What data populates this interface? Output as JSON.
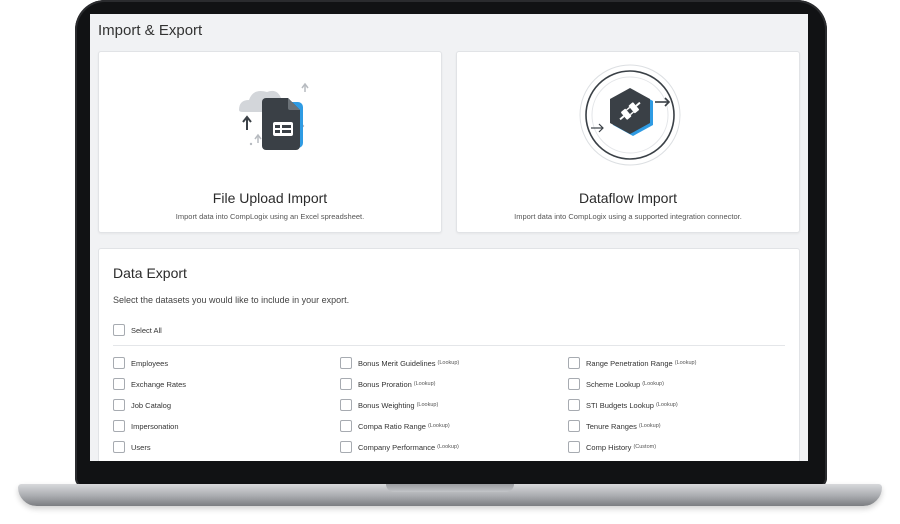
{
  "page": {
    "title": "Import & Export"
  },
  "import_cards": [
    {
      "title": "File Upload Import",
      "description": "Import data into CompLogix using an Excel spreadsheet."
    },
    {
      "title": "Dataflow Import",
      "description": "Import data into CompLogix using a supported integration connector."
    }
  ],
  "export": {
    "title": "Data Export",
    "subtitle": "Select the datasets you would like to include in your export.",
    "select_all_label": "Select All",
    "columns": [
      [
        {
          "label": "Employees",
          "tag": ""
        },
        {
          "label": "Exchange Rates",
          "tag": ""
        },
        {
          "label": "Job Catalog",
          "tag": ""
        },
        {
          "label": "Impersonation",
          "tag": ""
        },
        {
          "label": "Users",
          "tag": ""
        }
      ],
      [
        {
          "label": "Bonus Merit Guidelines",
          "tag": "(Lookup)"
        },
        {
          "label": "Bonus Proration",
          "tag": "(Lookup)"
        },
        {
          "label": "Bonus Weighting",
          "tag": "(Lookup)"
        },
        {
          "label": "Compa Ratio Range",
          "tag": "(Lookup)"
        },
        {
          "label": "Company Performance",
          "tag": "(Lookup)"
        }
      ],
      [
        {
          "label": "Range Penetration Range",
          "tag": "(Lookup)"
        },
        {
          "label": "Scheme Lookup",
          "tag": "(Lookup)"
        },
        {
          "label": "STI Budgets Lookup",
          "tag": "(Lookup)"
        },
        {
          "label": "Tenure Ranges",
          "tag": "(Lookup)"
        },
        {
          "label": "Comp History",
          "tag": "(Custom)"
        }
      ]
    ]
  },
  "colors": {
    "accent": "#2f9be3",
    "icon_dark": "#3a4046",
    "cloud": "#cfd3d8"
  },
  "icons": [
    "file-upload-icon",
    "dataflow-plug-icon"
  ]
}
